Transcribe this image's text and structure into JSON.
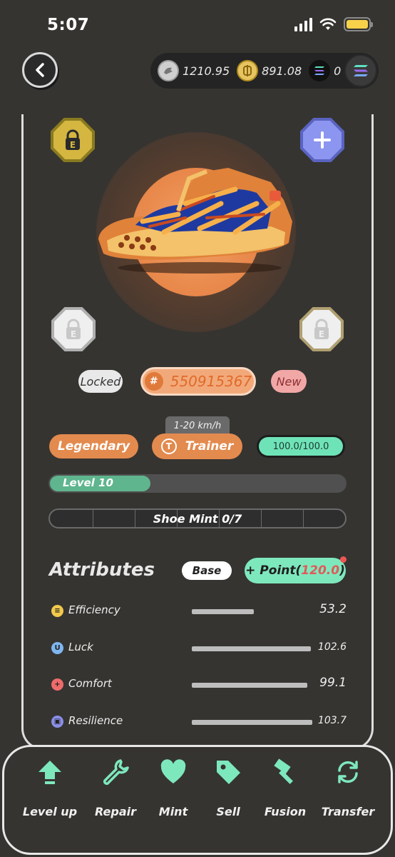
{
  "status": {
    "time": "5:07"
  },
  "wallet": {
    "gst": "1210.95",
    "gmt": "891.08",
    "sol": "0"
  },
  "shoe": {
    "status_tag": "Locked",
    "id": "550915367",
    "id_prefix": "#",
    "new_tag": "New",
    "speed": "1-20 km/h",
    "quality": "Legendary",
    "type": "Trainer",
    "type_icon": "T",
    "durability": "100.0/100.0",
    "durability_fraction": 1.0,
    "level_label": "Level 10",
    "level_fraction": 0.34,
    "mint_label": "Shoe Mint 0/7"
  },
  "attributes": {
    "title": "Attributes",
    "base_label": "Base",
    "point_label": "+ Point(",
    "point_value": "120.0",
    "point_close": ")",
    "rows": [
      {
        "name": "Efficiency",
        "value": "53.2",
        "fraction": 0.5,
        "color": "#f2c94c"
      },
      {
        "name": "Luck",
        "value": "102.6",
        "fraction": 0.96,
        "color": "#7fb6f0"
      },
      {
        "name": "Comfort",
        "value": "99.1",
        "fraction": 0.93,
        "color": "#ef6b6b"
      },
      {
        "name": "Resilience",
        "value": "103.7",
        "fraction": 0.97,
        "color": "#8a8fe8"
      }
    ]
  },
  "actions": [
    {
      "label": "Level up",
      "icon": "arrow-up-icon"
    },
    {
      "label": "Repair",
      "icon": "wrench-icon"
    },
    {
      "label": "Mint",
      "icon": "heart-icon"
    },
    {
      "label": "Sell",
      "icon": "tag-icon"
    },
    {
      "label": "Fusion",
      "icon": "hammer-icon"
    },
    {
      "label": "Transfer",
      "icon": "transfer-icon"
    }
  ],
  "colors": {
    "accent": "#7ee8bd",
    "orange": "#e38a4e",
    "background": "#353431"
  }
}
